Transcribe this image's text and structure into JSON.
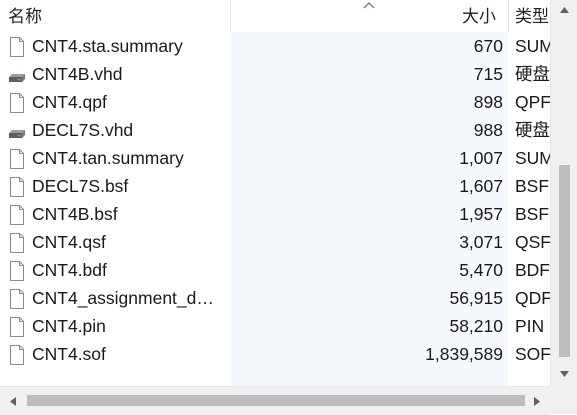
{
  "header": {
    "name_label": "名称",
    "size_label": "大小",
    "type_label": "类型"
  },
  "files": [
    {
      "name": "CNT4.sta.summary",
      "size": "670",
      "type": "SUM",
      "icon": "file-icon"
    },
    {
      "name": "CNT4B.vhd",
      "size": "715",
      "type": "硬盘",
      "icon": "disk-icon"
    },
    {
      "name": "CNT4.qpf",
      "size": "898",
      "type": "QPF",
      "icon": "file-icon"
    },
    {
      "name": "DECL7S.vhd",
      "size": "988",
      "type": "硬盘",
      "icon": "disk-icon"
    },
    {
      "name": "CNT4.tan.summary",
      "size": "1,007",
      "type": "SUM",
      "icon": "file-icon"
    },
    {
      "name": "DECL7S.bsf",
      "size": "1,607",
      "type": "BSF",
      "icon": "file-icon"
    },
    {
      "name": "CNT4B.bsf",
      "size": "1,957",
      "type": "BSF",
      "icon": "file-icon"
    },
    {
      "name": "CNT4.qsf",
      "size": "3,071",
      "type": "QSF",
      "icon": "file-icon"
    },
    {
      "name": "CNT4.bdf",
      "size": "5,470",
      "type": "BDF",
      "icon": "file-icon"
    },
    {
      "name": "CNT4_assignment_d…",
      "size": "56,915",
      "type": "QDF",
      "icon": "file-icon"
    },
    {
      "name": "CNT4.pin",
      "size": "58,210",
      "type": "PIN",
      "icon": "file-icon"
    },
    {
      "name": "CNT4.sof",
      "size": "1,839,589",
      "type": "SOF",
      "icon": "file-icon"
    }
  ],
  "sort": {
    "column": "size",
    "direction": "ascending",
    "icon": "sort-up-icon"
  },
  "colors": {
    "size_column_bg": "#f5f8fc",
    "scrollbar_thumb": "#bdbdbd",
    "scrollbar_track": "#f0f0f0"
  }
}
